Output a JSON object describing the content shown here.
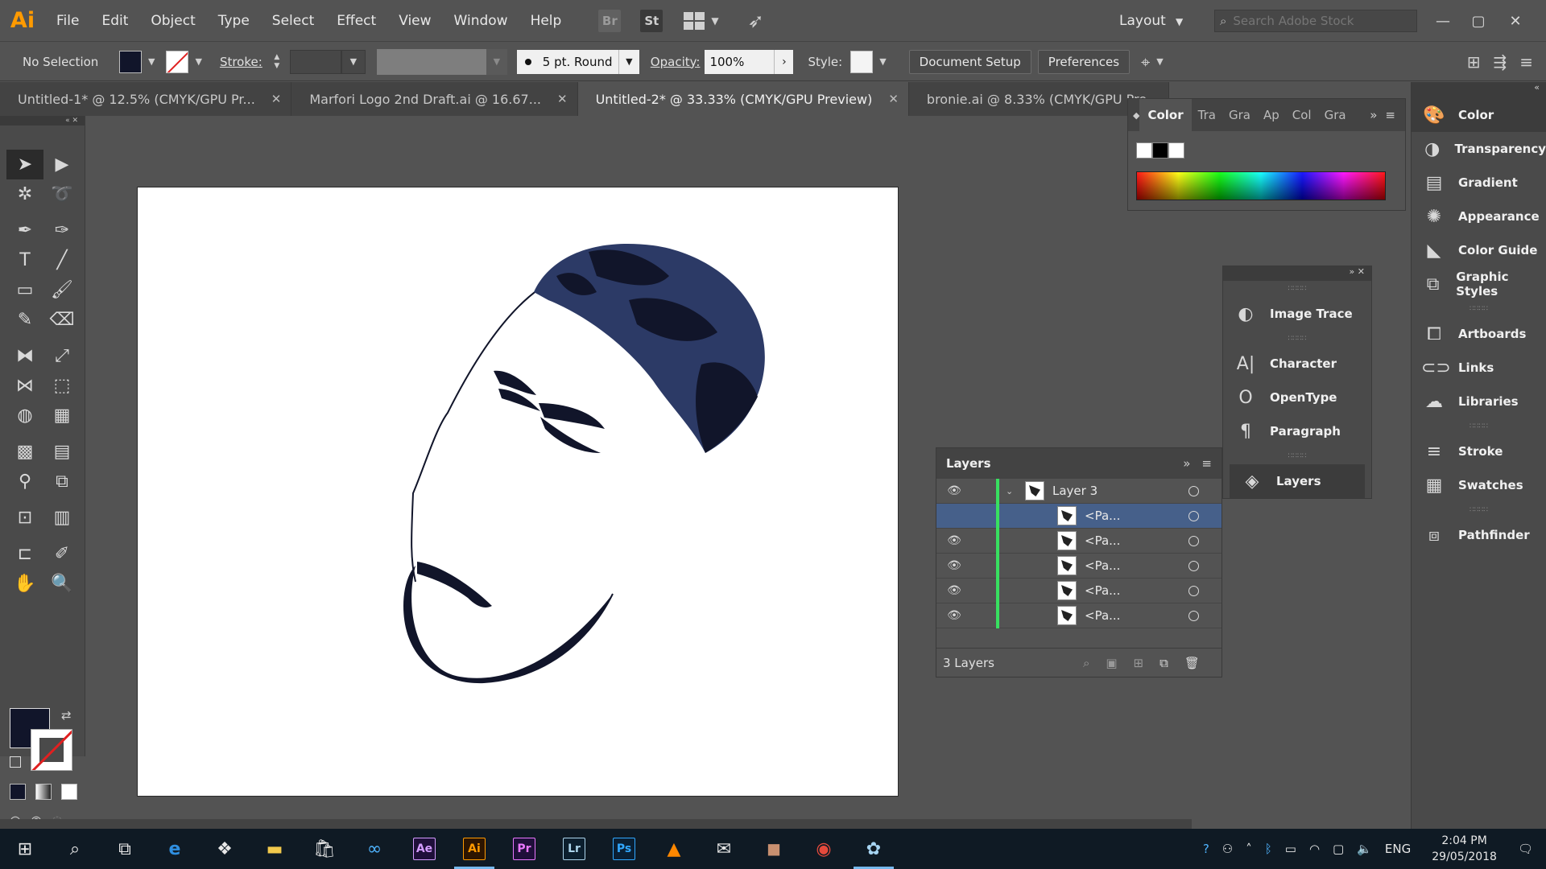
{
  "app": {
    "logo": "Ai",
    "accent": "#ff9a00"
  },
  "menu": [
    "File",
    "Edit",
    "Object",
    "Type",
    "Select",
    "Effect",
    "View",
    "Window",
    "Help"
  ],
  "bridge": {
    "br": "Br",
    "st": "St"
  },
  "workspace": {
    "label": "Layout"
  },
  "stock_search": {
    "placeholder": "Search Adobe Stock"
  },
  "control": {
    "selection": "No Selection",
    "stroke_label": "Stroke:",
    "brush": "5 pt. Round",
    "opacity_label": "Opacity:",
    "opacity_value": "100%",
    "style_label": "Style:",
    "document_setup": "Document Setup",
    "preferences": "Preferences"
  },
  "tabs": [
    {
      "label": "Untitled-1* @ 12.5% (CMYK/GPU Pr...",
      "active": false
    },
    {
      "label": "Marfori Logo 2nd Draft.ai @ 16.67...",
      "active": false
    },
    {
      "label": "Untitled-2* @ 33.33% (CMYK/GPU Preview)",
      "active": true
    },
    {
      "label": "bronie.ai @ 8.33% (CMYK/GPU Pre...",
      "active": false
    }
  ],
  "color_panel": {
    "title": "Color",
    "tabs": [
      "Tra",
      "Gra",
      "Ap",
      "Col",
      "Gra"
    ]
  },
  "mid_dock": {
    "items": [
      "Image Trace",
      "Character",
      "OpenType",
      "Paragraph",
      "Layers"
    ]
  },
  "right_dock": {
    "items": [
      "Color",
      "Transparency",
      "Gradient",
      "Appearance",
      "Color Guide",
      "Graphic Styles",
      "Artboards",
      "Links",
      "Libraries",
      "Stroke",
      "Swatches",
      "Pathfinder"
    ]
  },
  "layers": {
    "title": "Layers",
    "parent": "Layer 3",
    "rows": [
      "<Pa...",
      "<Pa...",
      "<Pa...",
      "<Pa...",
      "<Pa..."
    ],
    "count": "3 Layers"
  },
  "taskbar": {
    "lang": "ENG",
    "time": "2:04 PM",
    "date": "29/05/2018",
    "apps": [
      "Ae",
      "Ai",
      "Pr",
      "Lr",
      "Ps"
    ]
  },
  "colors": {
    "fill": "#11152a",
    "hair": "#2c3a66",
    "selected_row": "#46608a",
    "layer_color": "#38e060"
  }
}
